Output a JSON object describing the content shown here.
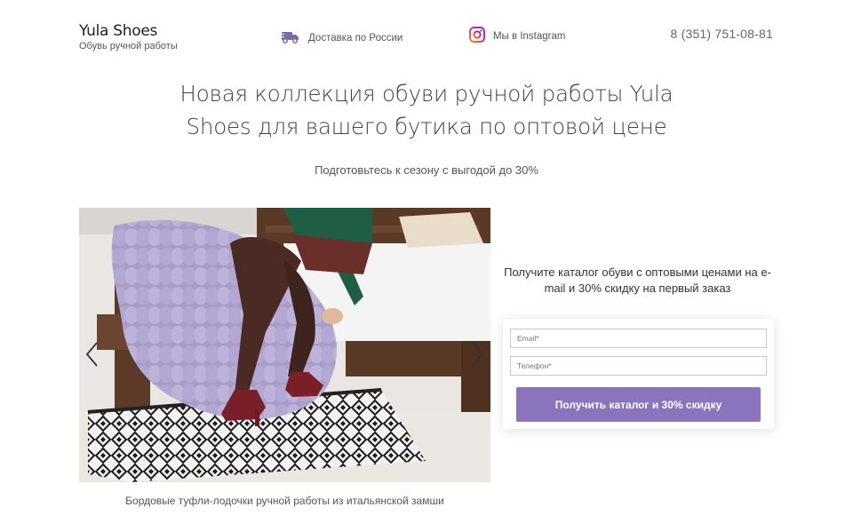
{
  "header": {
    "brand_name": "Yula Shoes",
    "brand_sub": "Обувь ручной работы",
    "delivery": {
      "label": "Доставка по России",
      "icon": "truck-icon"
    },
    "instagram": {
      "label": "Мы в Instagram",
      "icon": "instagram-icon"
    },
    "phone": "8 (351) 751-08-81"
  },
  "hero": {
    "title": "Новая коллекция обуви ручной работы Yula Shoes для вашего бутика по оптовой цене",
    "subtitle": "Подготовьтесь к сезону с выгодой до 30%"
  },
  "gallery": {
    "caption": "Бордовые туфли-лодочки ручной работы из итальянской замши",
    "prev_icon": "chevron-left-icon",
    "next_icon": "chevron-right-icon"
  },
  "offer": {
    "text": "Получите каталог обуви с оптовыми ценами на e-mail и 30% скидку на первый заказ"
  },
  "form": {
    "email_placeholder": "Email*",
    "phone_placeholder": "Телефон*",
    "submit_label": "Получить каталог и 30% скидку"
  },
  "colors": {
    "accent": "#8a74be",
    "instagram_gradient": [
      "#f58529",
      "#dd2a7b",
      "#8134af"
    ],
    "truck": "#7a6aa8"
  }
}
